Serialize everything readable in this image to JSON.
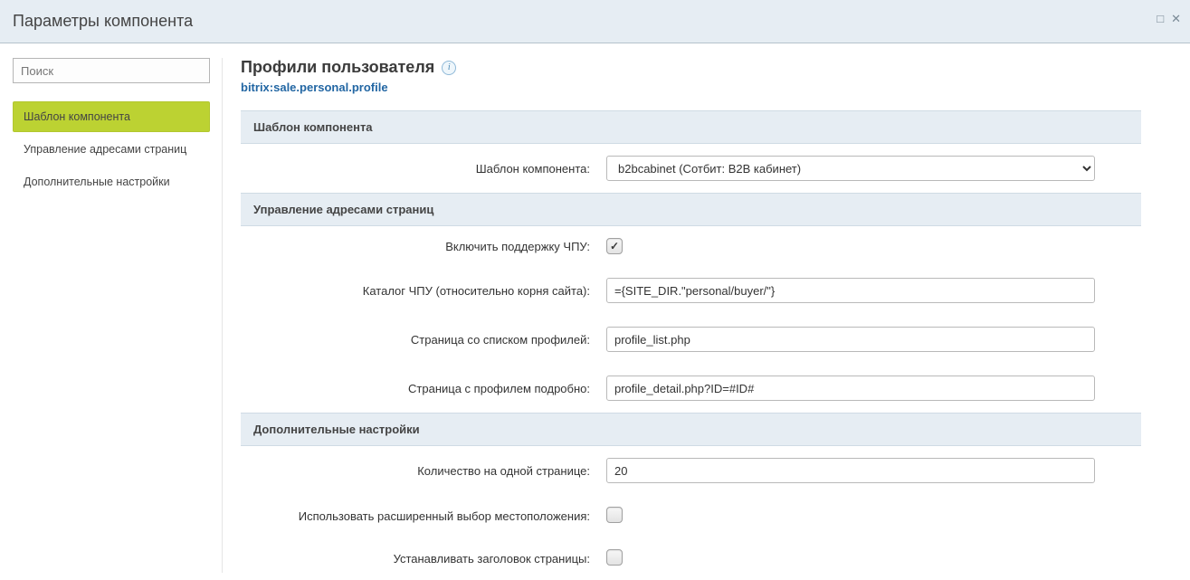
{
  "window": {
    "title": "Параметры компонента"
  },
  "sidebar": {
    "search_placeholder": "Поиск",
    "items": [
      {
        "label": "Шаблон компонента",
        "active": true
      },
      {
        "label": "Управление адресами страниц",
        "active": false
      },
      {
        "label": "Дополнительные настройки",
        "active": false
      }
    ]
  },
  "header": {
    "title": "Профили пользователя",
    "component_path": "bitrix:sale.personal.profile"
  },
  "sections": {
    "template": {
      "heading": "Шаблон компонента",
      "template_label": "Шаблон компонента:",
      "template_value": "b2bcabinet (Сотбит: B2B кабинет)"
    },
    "sef": {
      "heading": "Управление адресами страниц",
      "sef_enable_label": "Включить поддержку ЧПУ:",
      "sef_enable_checked": true,
      "sef_folder_label": "Каталог ЧПУ (относительно корня сайта):",
      "sef_folder_value": "={SITE_DIR.\"personal/buyer/\"}",
      "list_page_label": "Страница со списком профилей:",
      "list_page_value": "profile_list.php",
      "detail_page_label": "Страница с профилем подробно:",
      "detail_page_value": "profile_detail.php?ID=#ID#"
    },
    "extra": {
      "heading": "Дополнительные настройки",
      "per_page_label": "Количество на одной странице:",
      "per_page_value": "20",
      "ext_location_label": "Использовать расширенный выбор местоположения:",
      "ext_location_checked": false,
      "set_title_label": "Устанавливать заголовок страницы:",
      "set_title_checked": false
    }
  }
}
